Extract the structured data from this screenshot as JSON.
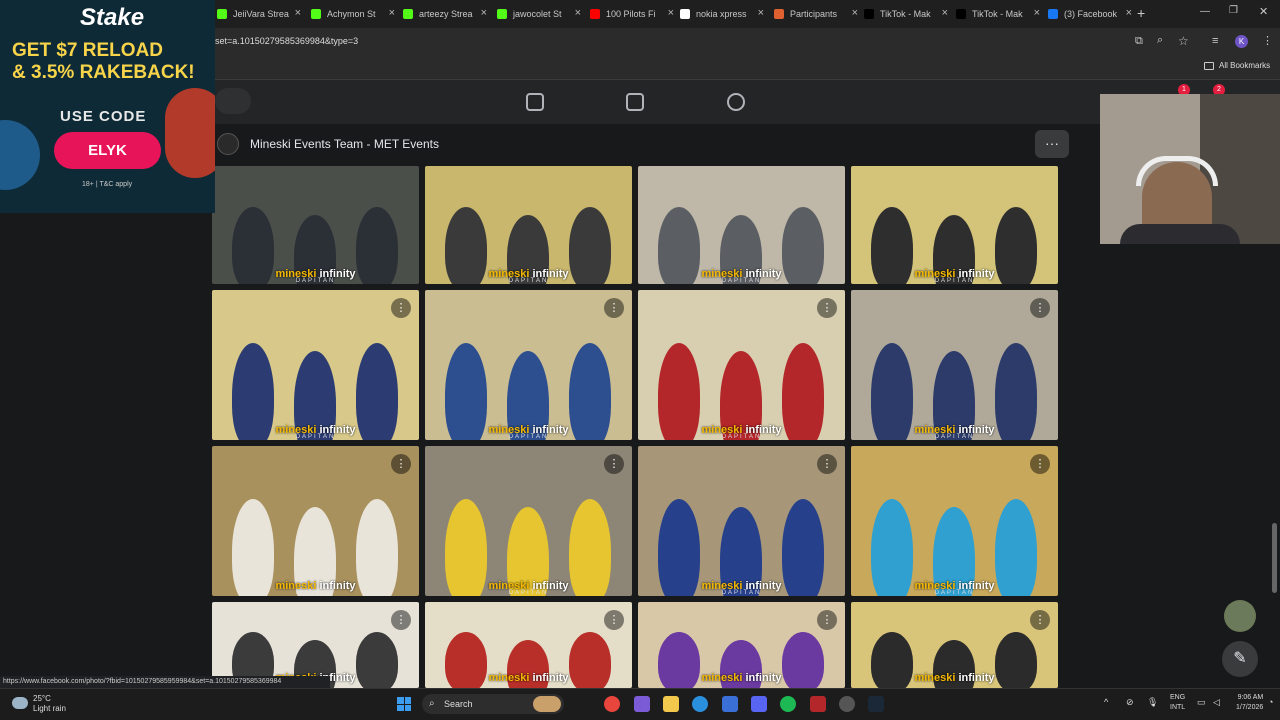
{
  "browser": {
    "tabs": [
      {
        "label": "JeiiVara Strea",
        "color": "#53fc18"
      },
      {
        "label": "Achymon St",
        "color": "#53fc18"
      },
      {
        "label": "arteezy Strea",
        "color": "#53fc18"
      },
      {
        "label": "jawocolet St",
        "color": "#53fc18"
      },
      {
        "label": "100 Pilots Fi",
        "color": "#ff0000"
      },
      {
        "label": "nokia xpress",
        "color": "#ffffff"
      },
      {
        "label": "Participants",
        "color": "#e06030"
      },
      {
        "label": "TikTok - Mak",
        "color": "#000000"
      },
      {
        "label": "TikTok - Mak",
        "color": "#000000"
      },
      {
        "label": "(3) Facebook",
        "color": "#1877f2"
      }
    ],
    "url": "set=a.10150279585369984&type=3",
    "bookmarks_label": "All Bookmarks",
    "profile_initial": "K"
  },
  "ad": {
    "brand": "Stake",
    "line1": "GET $7 RELOAD",
    "line2": "& 3.5% RAKEBACK!",
    "code_label": "USE CODE",
    "code": "ELYK",
    "terms": "18+ | T&C apply"
  },
  "facebook": {
    "notif_count_1": "1",
    "notif_count_2": "2",
    "album_title": "Mineski Events Team - MET Events",
    "more_label": "···",
    "watermark_brand": "mineski",
    "watermark_suffix": "infinity",
    "watermark_sub": "DAPITAN",
    "photos": [
      {
        "bg": "#4a4f4a",
        "accent": "#2b2f36"
      },
      {
        "bg": "#c9b76e",
        "accent": "#3a3a3a"
      },
      {
        "bg": "#bfb8a8",
        "accent": "#5b5e63"
      },
      {
        "bg": "#d3c47a",
        "accent": "#2e2e2e"
      },
      {
        "bg": "#d8c98a",
        "accent": "#2c3c72"
      },
      {
        "bg": "#cbbd92",
        "accent": "#2d4f8f"
      },
      {
        "bg": "#d8cfb0",
        "accent": "#b3262a"
      },
      {
        "bg": "#b0a99a",
        "accent": "#2d3b6a"
      },
      {
        "bg": "#a9915e",
        "accent": "#e9e4da"
      },
      {
        "bg": "#8d8576",
        "accent": "#e6c530"
      },
      {
        "bg": "#a79778",
        "accent": "#27408b"
      },
      {
        "bg": "#c8a85a",
        "accent": "#2fa0d0"
      },
      {
        "bg": "#e6e2d7",
        "accent": "#3b3b3b"
      },
      {
        "bg": "#e4ddc7",
        "accent": "#b82f2a"
      },
      {
        "bg": "#d8c8a8",
        "accent": "#6b3aa0"
      },
      {
        "bg": "#d8c57a",
        "accent": "#2b2b2b"
      }
    ]
  },
  "status_url": "https://www.facebook.com/photo/?fbid=10150279585959984&set=a.10150279585369984",
  "taskbar": {
    "temp": "25°C",
    "weather": "Light rain",
    "search_placeholder": "Search",
    "lang_1": "ENG",
    "lang_2": "INTL",
    "time": "9:06 AM",
    "date": "1/7/2026"
  }
}
